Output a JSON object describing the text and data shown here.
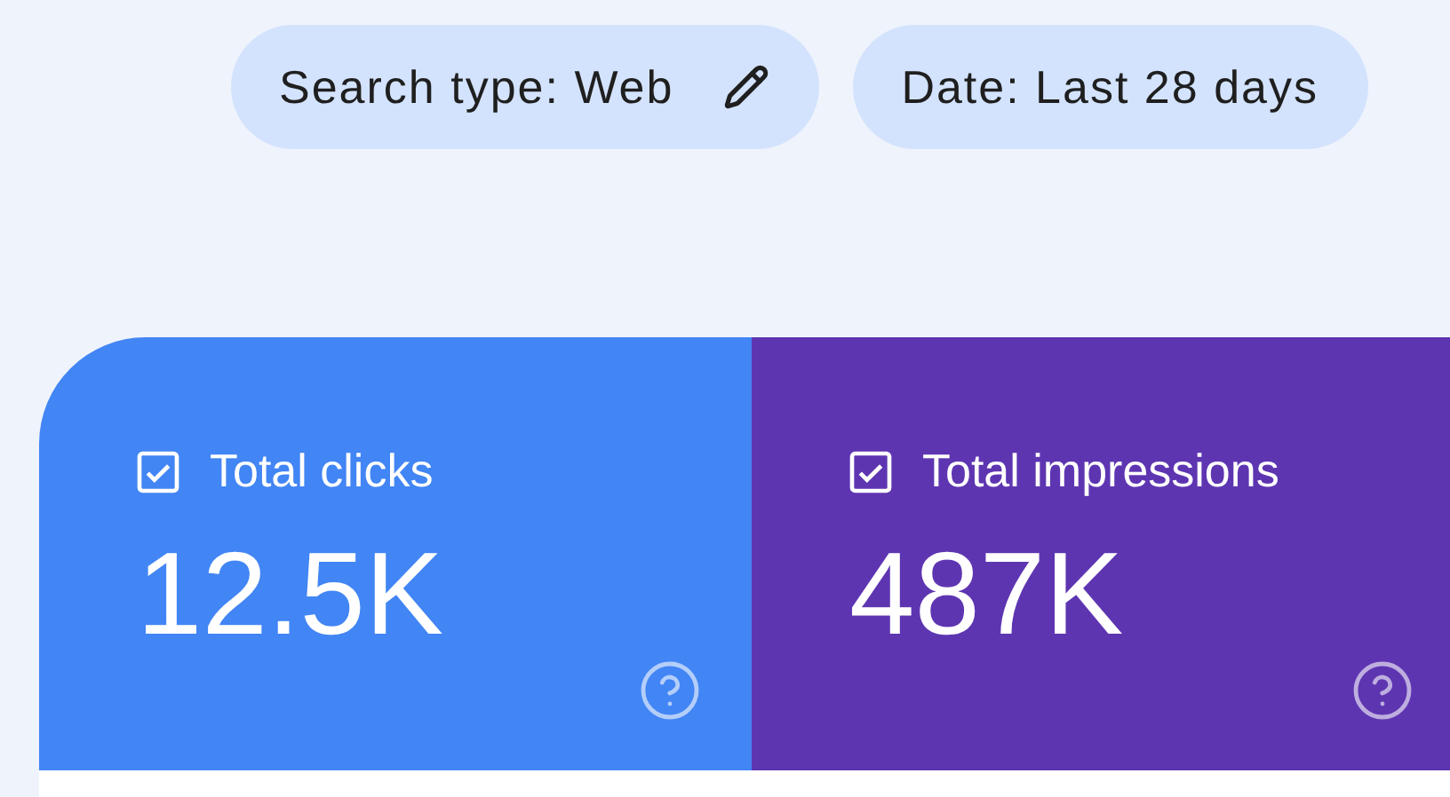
{
  "filters": [
    {
      "label": "Search type: Web",
      "editable": true
    },
    {
      "label": "Date: Last 28 days",
      "editable": false
    }
  ],
  "metrics": [
    {
      "label": "Total clicks",
      "value": "12.5K",
      "checked": true,
      "color": "#4285f4"
    },
    {
      "label": "Total impressions",
      "value": "487K",
      "checked": true,
      "color": "#5e35b1"
    }
  ]
}
